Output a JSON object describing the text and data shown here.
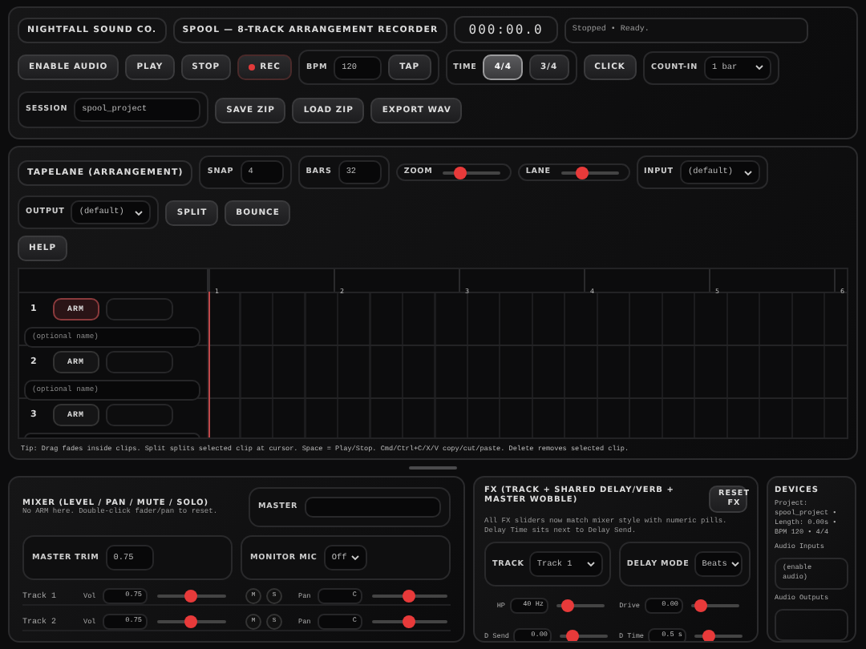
{
  "header": {
    "brand": "NIGHTFALL SOUND CO.",
    "app_title": "SPOOL — 8-TRACK ARRANGEMENT RECORDER",
    "time": "000:00.0",
    "status": "Stopped • Ready."
  },
  "transport": [
    {
      "kind": "button",
      "label": "ENABLE AUDIO"
    },
    {
      "kind": "button",
      "label": "PLAY"
    },
    {
      "kind": "button",
      "label": "STOP"
    },
    {
      "kind": "record",
      "label": "REC"
    }
  ],
  "bpm": {
    "label": "BPM",
    "value": "120",
    "tap": "TAP"
  },
  "time_signature": {
    "label": "TIME",
    "options": [
      {
        "label": "4/4",
        "selected": true
      },
      {
        "label": "3/4",
        "selected": false
      }
    ]
  },
  "click": "CLICK",
  "count_in": {
    "label": "COUNT-IN",
    "value": "1 bar"
  },
  "session": {
    "label": "SESSION",
    "value": "spool_project",
    "buttons": [
      "SAVE ZIP",
      "LOAD ZIP",
      "EXPORT WAV"
    ]
  },
  "tapelane": {
    "title": "TAPELANE (ARRANGEMENT)",
    "snap": {
      "label": "SNAP",
      "value": "4"
    },
    "bars": {
      "label": "BARS",
      "value": "32"
    },
    "zoom": {
      "label": "ZOOM",
      "level": 0.27
    },
    "lane": {
      "label": "LANE",
      "level": 0.33
    },
    "input": {
      "label": "INPUT",
      "value": "(default)"
    },
    "output": {
      "label": "OUTPUT",
      "value": "(default)"
    },
    "buttons": [
      "SPLIT",
      "BOUNCE"
    ],
    "help": "HELP"
  },
  "ruler": [
    "1",
    "2",
    "3",
    "4",
    "5",
    "6"
  ],
  "tracks": [
    {
      "number": "1",
      "arm": "ARM",
      "armed": true,
      "name_placeholder": "(optional name)"
    },
    {
      "number": "2",
      "arm": "ARM",
      "armed": false,
      "name_placeholder": "(optional name)"
    },
    {
      "number": "3",
      "arm": "ARM",
      "armed": false
    }
  ],
  "tip": "Tip: Drag fades inside clips. Split splits selected clip at cursor. Space = Play/Stop. Cmd/Ctrl+C/X/V copy/cut/paste. Delete removes selected clip.",
  "mixer": {
    "title": "MIXER (LEVEL / PAN / MUTE / SOLO)",
    "subtitle": "No ARM here. Double-click fader/pan to reset.",
    "master": "MASTER",
    "master_trim": {
      "label": "MASTER TRIM",
      "value": "0.75"
    },
    "monitor_mic": {
      "label": "MONITOR MIC",
      "value": "Off"
    },
    "tracks": [
      {
        "name": "Track 1",
        "vol_label": "Vol",
        "vol": {
          "value": "0.75",
          "level": 0.5
        },
        "mute": "M",
        "solo": "S",
        "pan_label": "Pan",
        "pan": {
          "value": "C",
          "level": 0.5
        }
      },
      {
        "name": "Track 2",
        "vol_label": "Vol",
        "vol": {
          "value": "0.75",
          "level": 0.5
        },
        "mute": "M",
        "solo": "S",
        "pan_label": "Pan",
        "pan": {
          "value": "C",
          "level": 0.5
        }
      }
    ]
  },
  "fx": {
    "title": "FX (TRACK + SHARED DELAY/VERB + MASTER WOBBLE)",
    "reset": "RESET FX",
    "description": "All FX sliders now match mixer style with numeric pills. Delay Time sits next to Delay Send.",
    "track": {
      "label": "TRACK",
      "value": "Track 1"
    },
    "delay_mode": {
      "label": "DELAY MODE",
      "value": "Beats"
    },
    "params": [
      {
        "label": "HP",
        "value": "40 Hz",
        "level": 0.12
      },
      {
        "label": "Drive",
        "value": "0.00",
        "level": 0.1
      },
      {
        "label": "D Send",
        "value": "0.00",
        "level": 0.15
      },
      {
        "label": "D Time",
        "value": "0.5 s",
        "level": 0.22
      }
    ]
  },
  "devices": {
    "title": "DEVICES",
    "project": "Project: spool_project • Length: 0.00s • BPM 120 • 4/4",
    "inputs_label": "Audio Inputs",
    "inputs": "(enable audio)",
    "outputs_label": "Audio Outputs"
  }
}
